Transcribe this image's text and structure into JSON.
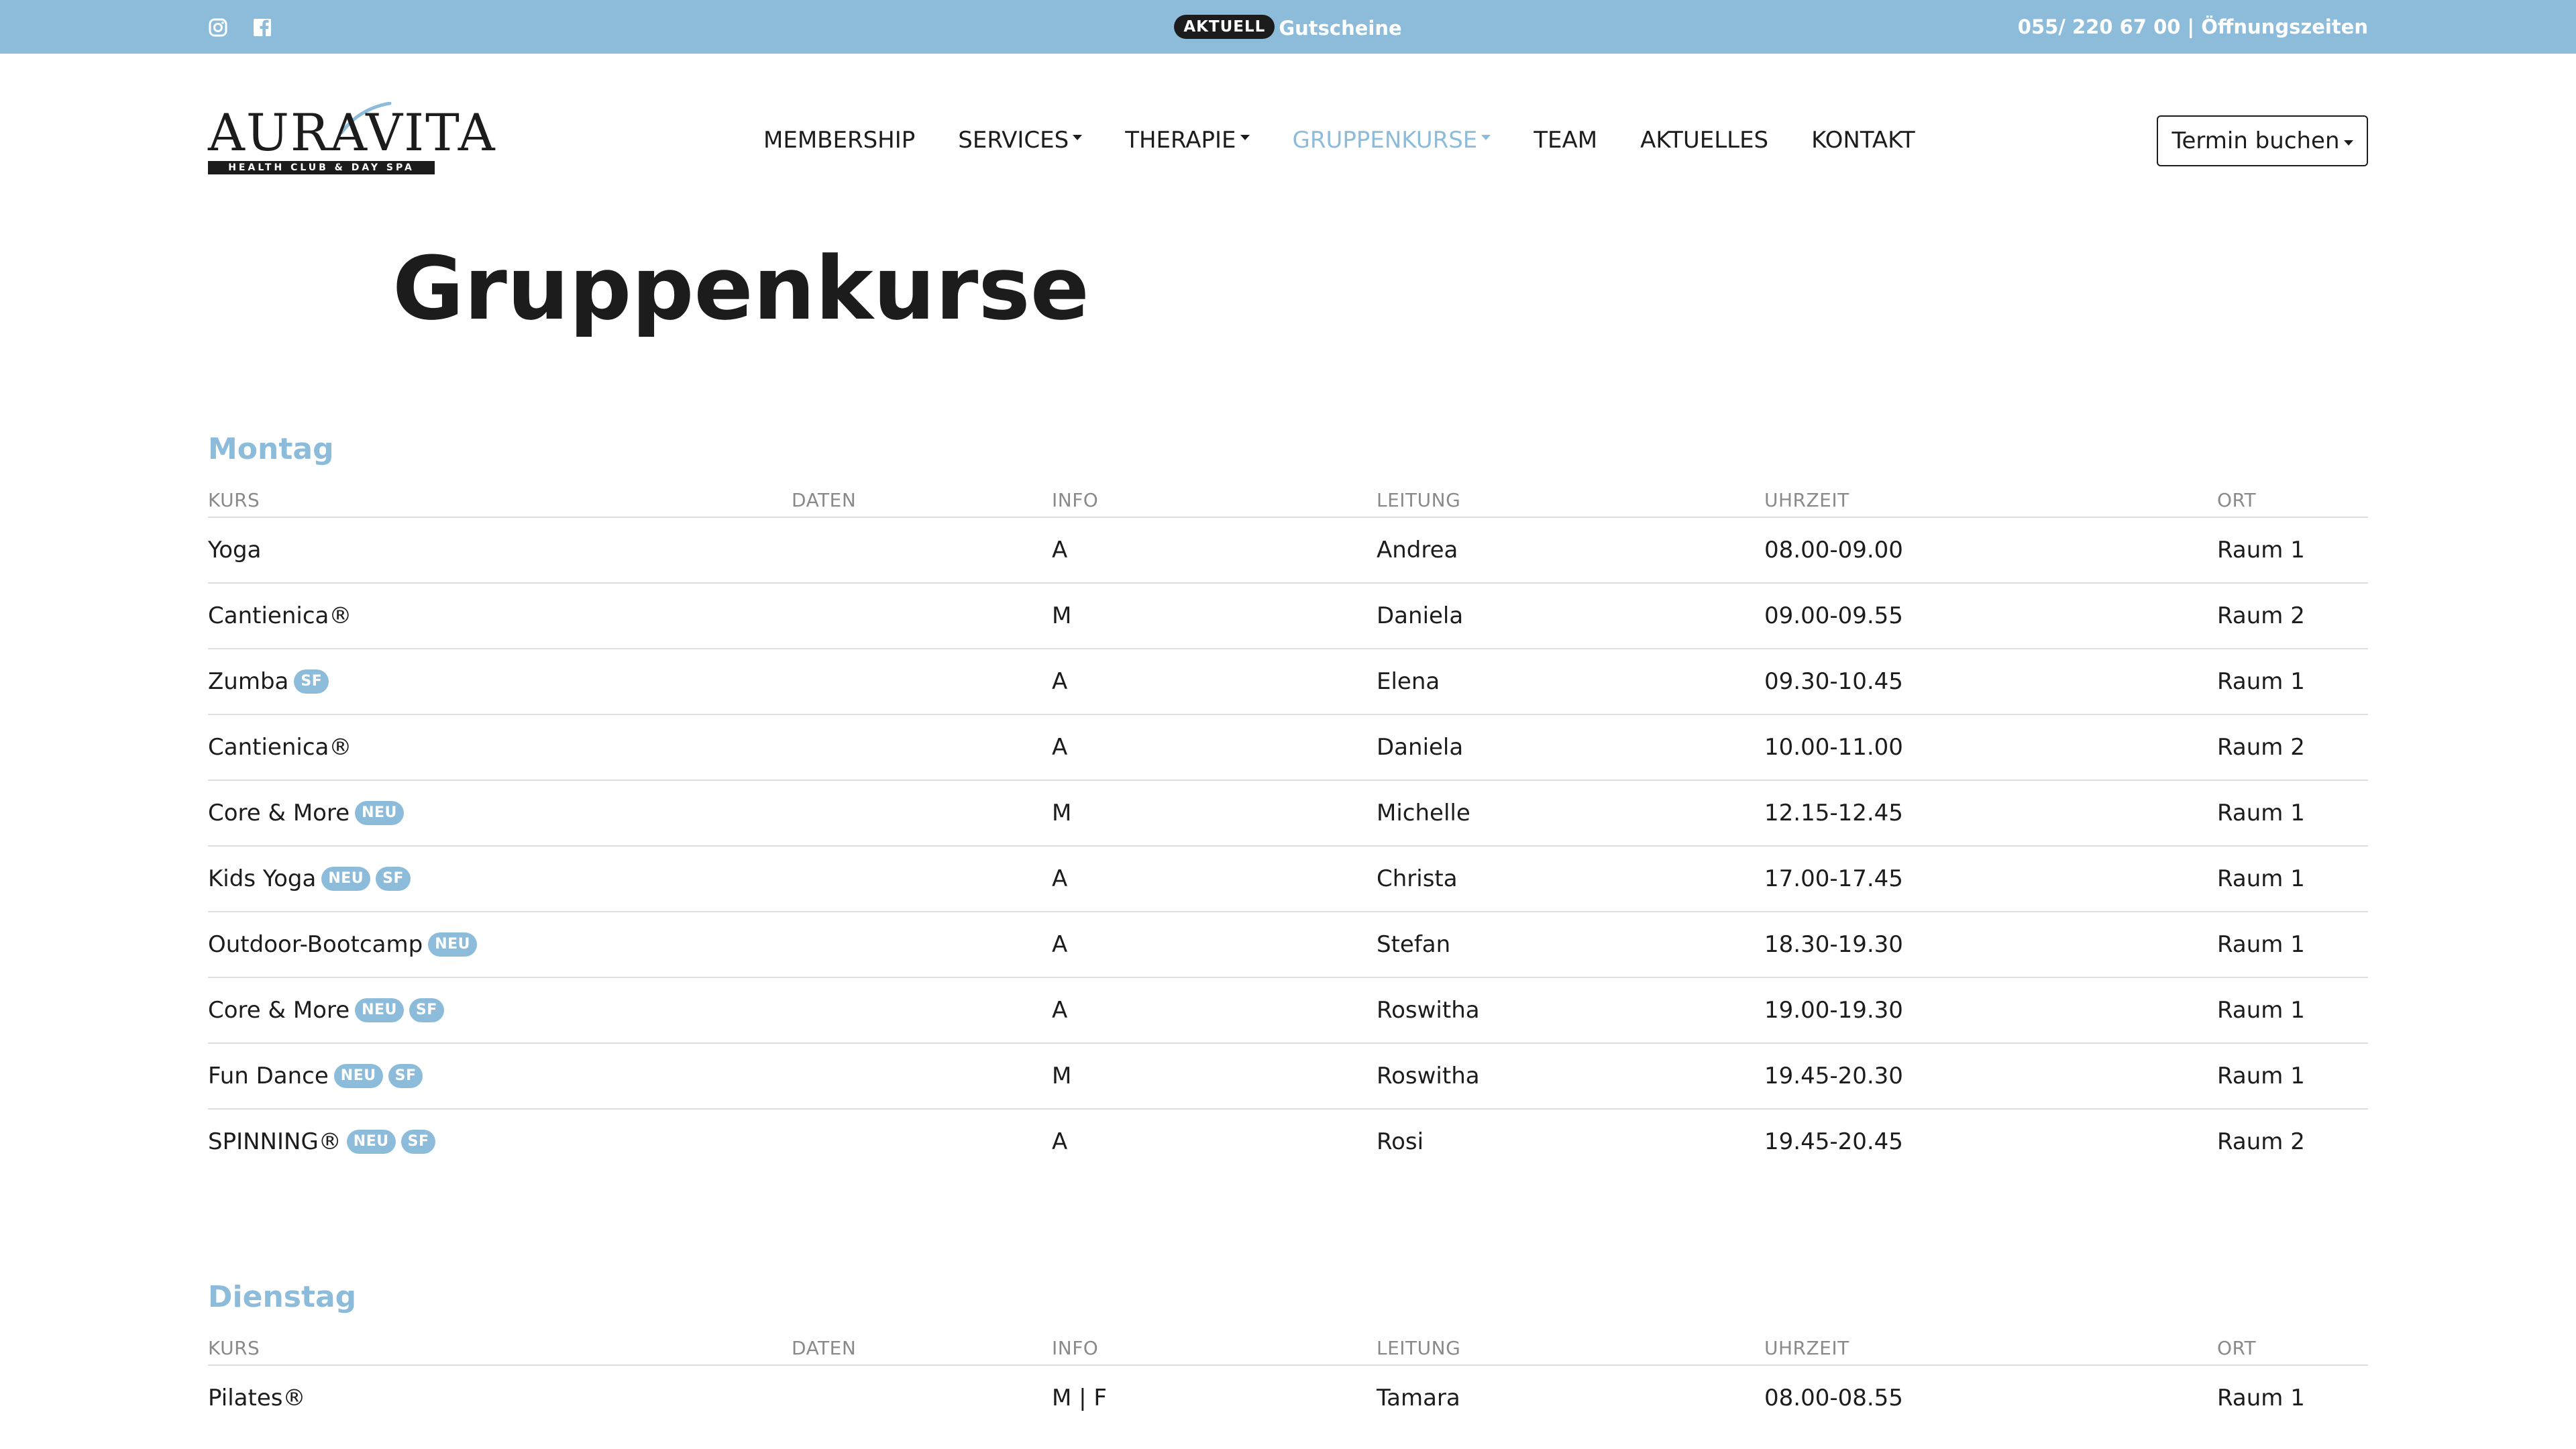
{
  "topbar": {
    "social": [
      {
        "name": "instagram-icon"
      },
      {
        "name": "facebook-icon"
      }
    ],
    "promo_badge": "AKTUELL",
    "promo_link": "Gutscheine",
    "phone": "055/ 220 67 00",
    "separator": " | ",
    "hours_link": "Öffnungszeiten",
    "bar_color": "#8dbcdb"
  },
  "header": {
    "logo_text": "AURAVITA",
    "logo_tagline": "HEALTH CLUB & DAY SPA",
    "nav": [
      {
        "label": "MEMBERSHIP",
        "dropdown": false,
        "active": false
      },
      {
        "label": "SERVICES",
        "dropdown": true,
        "active": false
      },
      {
        "label": "THERAPIE",
        "dropdown": true,
        "active": false
      },
      {
        "label": "GRUPPENKURSE",
        "dropdown": true,
        "active": true
      },
      {
        "label": "TEAM",
        "dropdown": false,
        "active": false
      },
      {
        "label": "AKTUELLES",
        "dropdown": false,
        "active": false
      },
      {
        "label": "KONTAKT",
        "dropdown": false,
        "active": false
      }
    ],
    "book_button": "Termin buchen"
  },
  "page": {
    "title": "Gruppenkurse",
    "accent_color": "#8dbcdb"
  },
  "columns": {
    "kurs": "KURS",
    "daten": "DATEN",
    "info": "INFO",
    "leitung": "LEITUNG",
    "uhrzeit": "UHRZEIT",
    "ort": "ORT"
  },
  "days": [
    {
      "name": "Montag",
      "rows": [
        {
          "kurs": "Yoga",
          "tags": [],
          "daten": "",
          "info": "A",
          "leitung": "Andrea",
          "uhrzeit": "08.00-09.00",
          "ort": "Raum 1"
        },
        {
          "kurs": "Cantienica®",
          "tags": [],
          "daten": "",
          "info": "M",
          "leitung": "Daniela",
          "uhrzeit": "09.00-09.55",
          "ort": "Raum 2"
        },
        {
          "kurs": "Zumba",
          "tags": [
            "SF"
          ],
          "daten": "",
          "info": "A",
          "leitung": "Elena",
          "uhrzeit": "09.30-10.45",
          "ort": "Raum 1"
        },
        {
          "kurs": "Cantienica®",
          "tags": [],
          "daten": "",
          "info": "A",
          "leitung": "Daniela",
          "uhrzeit": "10.00-11.00",
          "ort": "Raum 2"
        },
        {
          "kurs": "Core & More",
          "tags": [
            "NEU"
          ],
          "daten": "",
          "info": "M",
          "leitung": "Michelle",
          "uhrzeit": "12.15-12.45",
          "ort": "Raum 1"
        },
        {
          "kurs": "Kids Yoga",
          "tags": [
            "NEU",
            "SF"
          ],
          "daten": "",
          "info": "A",
          "leitung": "Christa",
          "uhrzeit": "17.00-17.45",
          "ort": "Raum 1"
        },
        {
          "kurs": "Outdoor-Bootcamp",
          "tags": [
            "NEU"
          ],
          "daten": "",
          "info": "A",
          "leitung": "Stefan",
          "uhrzeit": "18.30-19.30",
          "ort": "Raum 1"
        },
        {
          "kurs": "Core & More",
          "tags": [
            "NEU",
            "SF"
          ],
          "daten": "",
          "info": "A",
          "leitung": "Roswitha",
          "uhrzeit": "19.00-19.30",
          "ort": "Raum 1"
        },
        {
          "kurs": "Fun Dance",
          "tags": [
            "NEU",
            "SF"
          ],
          "daten": "",
          "info": "M",
          "leitung": "Roswitha",
          "uhrzeit": "19.45-20.30",
          "ort": "Raum 1"
        },
        {
          "kurs": "SPINNING®",
          "tags": [
            "NEU",
            "SF"
          ],
          "daten": "",
          "info": "A",
          "leitung": "Rosi",
          "uhrzeit": "19.45-20.45",
          "ort": "Raum 2"
        }
      ]
    },
    {
      "name": "Dienstag",
      "rows": [
        {
          "kurs": "Pilates®",
          "tags": [],
          "daten": "",
          "info": "M | F",
          "leitung": "Tamara",
          "uhrzeit": "08.00-08.55",
          "ort": "Raum 1"
        }
      ]
    }
  ]
}
